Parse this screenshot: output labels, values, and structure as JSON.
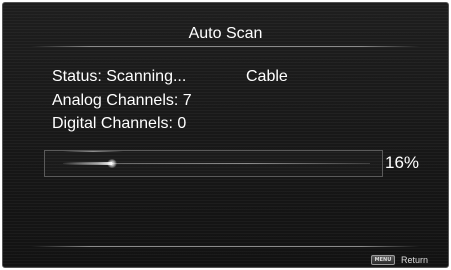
{
  "dialog": {
    "title": "Auto Scan"
  },
  "status": {
    "line": "Status: Scanning...",
    "source": "Cable"
  },
  "channels": {
    "analog_line": "Analog Channels: 7",
    "digital_line": "Digital Channels: 0"
  },
  "progress": {
    "percent_label": "16%",
    "fraction": 0.16
  },
  "footer": {
    "key_label": "MENU",
    "return_label": "Return",
    "key_icon": "menu-key-icon"
  },
  "colors": {
    "background": "#161616",
    "text": "#ffffff",
    "divider": "#8a8a8a"
  }
}
